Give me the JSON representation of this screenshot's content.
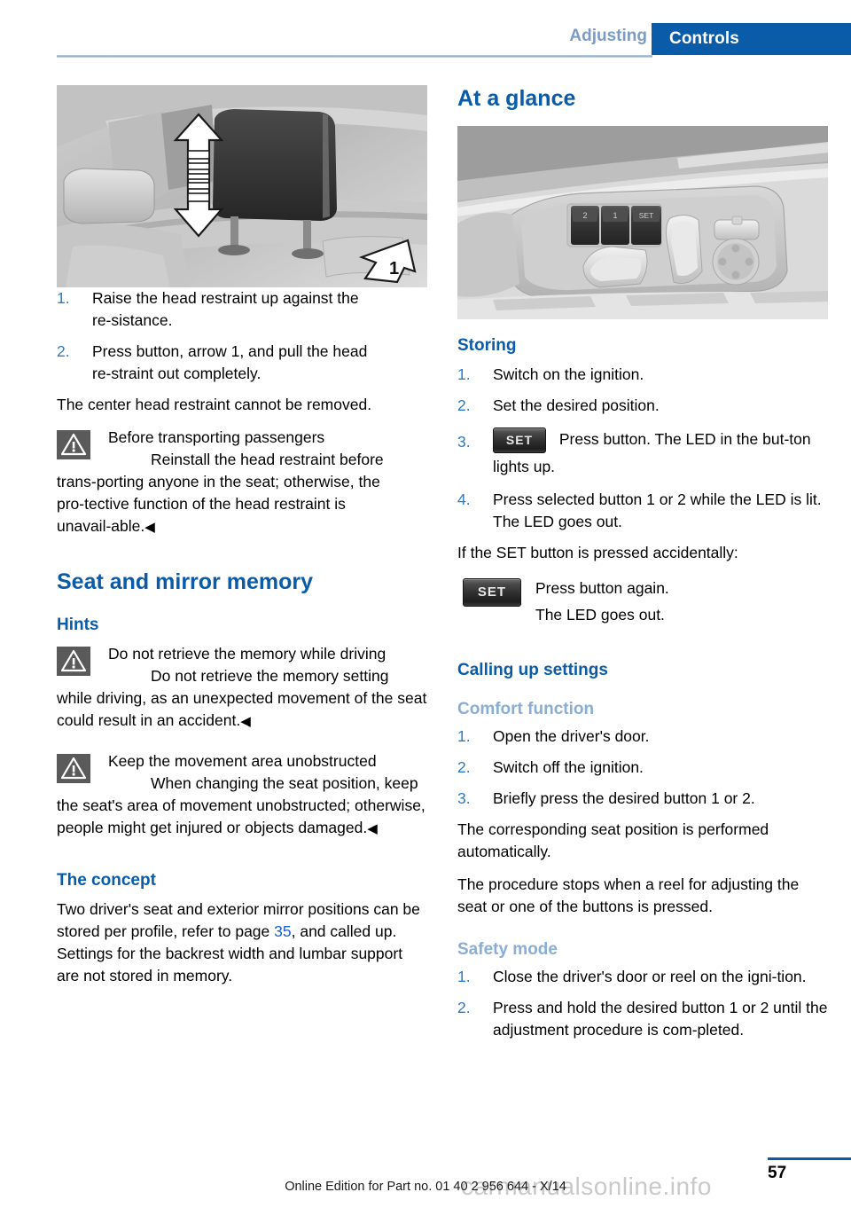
{
  "header": {
    "previous_tab": "Adjusting",
    "active_tab": "Controls",
    "accent_color": "#0a5ba8",
    "muted_tab_color": "#7c9cc4"
  },
  "left_column": {
    "figure": {
      "name": "head-restraint-illustration",
      "callout_label": "1"
    },
    "steps": [
      {
        "num": "1.",
        "text": "Raise the head restraint up against the re‑sistance."
      },
      {
        "num": "2.",
        "text": "Press button, arrow 1, and pull the head re‑straint out completely."
      }
    ],
    "note": "The center head restraint cannot be removed.",
    "warning_1": {
      "title": "Before transporting passengers",
      "body": "Reinstall the head restraint before trans‑porting anyone in the seat; otherwise, the pro‑tective function of the head restraint is unavail‑able.",
      "end_marker": "◀"
    },
    "section_title": "Seat and mirror memory",
    "hints_title": "Hints",
    "warning_2": {
      "title": "Do not retrieve the memory while driving",
      "body": "Do not retrieve the memory setting while driving, as an unexpected movement of the seat could result in an accident.",
      "end_marker": "◀"
    },
    "warning_3": {
      "title": "Keep the movement area unobstructed",
      "body": "When changing the seat position, keep the seat's area of movement unobstructed; otherwise, people might get injured or objects damaged.",
      "end_marker": "◀"
    },
    "concept_title": "The concept",
    "concept_text_before": "Two driver's seat and exterior mirror positions can be stored per profile, refer to page ",
    "concept_page_ref": "35",
    "concept_text_after": ", and called up. Settings for the backrest width and lumbar support are not stored in memory."
  },
  "right_column": {
    "at_a_glance_title": "At a glance",
    "figure": {
      "name": "seat-memory-control-panel",
      "button_labels": [
        "2",
        "1",
        "SET"
      ]
    },
    "storing_title": "Storing",
    "storing_steps": [
      {
        "num": "1.",
        "text": "Switch on the ignition.",
        "button": null
      },
      {
        "num": "2.",
        "text": "Set the desired position.",
        "button": null
      },
      {
        "num": "3.",
        "text": "Press button. The LED in the but‑ton lights up.",
        "button": "SET"
      },
      {
        "num": "4.",
        "text": "Press selected button 1 or 2 while the LED is lit. The LED goes out.",
        "button": null
      }
    ],
    "accidental_note": "If the SET button is pressed accidentally:",
    "accidental_block": {
      "button": "SET",
      "line1": "Press button again.",
      "line2": "The LED goes out."
    },
    "calling_up_title": "Calling up settings",
    "comfort_title": "Comfort function",
    "comfort_steps": [
      {
        "num": "1.",
        "text": "Open the driver's door."
      },
      {
        "num": "2.",
        "text": "Switch off the ignition."
      },
      {
        "num": "3.",
        "text": "Briefly press the desired button 1 or 2."
      }
    ],
    "comfort_note_1": "The corresponding seat position is performed automatically.",
    "comfort_note_2": "The procedure stops when a reel for adjusting the seat or one of the buttons is pressed.",
    "safety_title": "Safety mode",
    "safety_steps": [
      {
        "num": "1.",
        "text": "Close the driver's door or reel on the igni‑tion."
      },
      {
        "num": "2.",
        "text": "Press and hold the desired button 1 or 2 until the adjustment procedure is com‑pleted."
      }
    ]
  },
  "footer": {
    "page_number": "57",
    "edition_text": "Online Edition for Part no. 01 40 2 956 644 - X/14",
    "watermark": "carmanualsonline.info"
  }
}
